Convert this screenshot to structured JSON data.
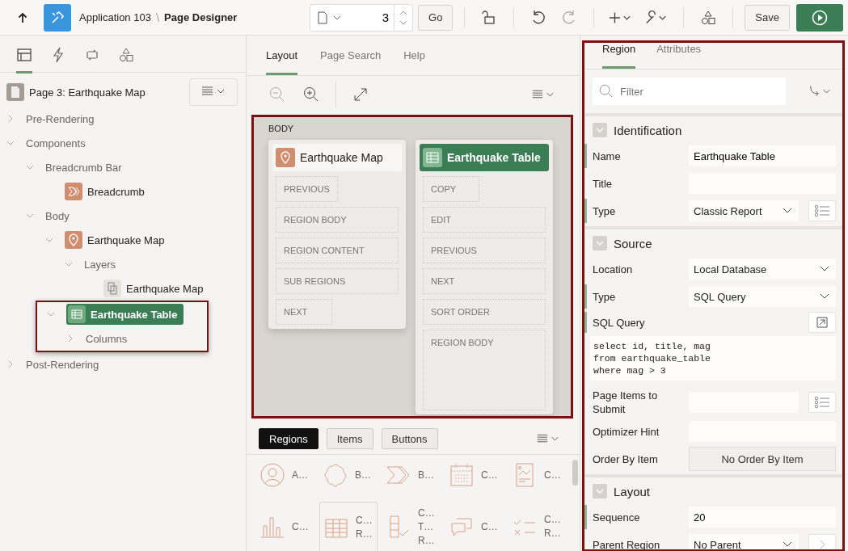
{
  "header": {
    "app_name": "Application 103",
    "separator": "\\",
    "page_title": "Page Designer",
    "page_number": "3",
    "go_label": "Go",
    "save_label": "Save"
  },
  "left_tabs": [
    {
      "kind": "tree",
      "selected": true
    },
    {
      "kind": "bolt",
      "selected": false
    },
    {
      "kind": "cycle",
      "selected": false
    },
    {
      "kind": "shapes",
      "selected": false
    }
  ],
  "tree": {
    "page_label": "Page 3: Earthquake Map",
    "nodes": [
      {
        "label": "Pre-Rendering",
        "expanded": false,
        "selected": false
      },
      {
        "label": "Components",
        "expanded": true,
        "selected": false,
        "children": [
          {
            "label": "Breadcrumb Bar",
            "expanded": true,
            "selected": false,
            "children": [
              {
                "label": "Breadcrumb",
                "kind": "breadcrumb",
                "selected": false
              }
            ]
          },
          {
            "label": "Body",
            "expanded": true,
            "selected": false,
            "children": [
              {
                "label": "Earthquake Map",
                "kind": "map",
                "expanded": true,
                "selected": false,
                "children": [
                  {
                    "label": "Layers",
                    "expanded": true,
                    "selected": false,
                    "children": [
                      {
                        "label": "Earthquake Map",
                        "kind": "layer",
                        "selected": false
                      }
                    ]
                  }
                ]
              },
              {
                "label": "Earthquake Table",
                "kind": "table",
                "expanded": true,
                "selected": true,
                "highlighted": true,
                "children": [
                  {
                    "label": "Columns",
                    "expanded": false,
                    "selected": false
                  }
                ]
              }
            ]
          }
        ]
      },
      {
        "label": "Post-Rendering",
        "expanded": false,
        "selected": false
      }
    ]
  },
  "center_tabs": [
    {
      "label": "Layout",
      "selected": true
    },
    {
      "label": "Page Search",
      "selected": false
    },
    {
      "label": "Help",
      "selected": false
    }
  ],
  "canvas": {
    "label": "BODY",
    "highlighted": true,
    "regions": [
      {
        "title": "Earthquake Map",
        "kind": "map",
        "selected": false,
        "slots": [
          "PREVIOUS",
          "REGION BODY",
          "REGION CONTENT",
          "SUB REGIONS",
          "NEXT"
        ]
      },
      {
        "title": "Earthquake Table",
        "kind": "table",
        "selected": true,
        "slots": [
          "COPY",
          "EDIT",
          "PREVIOUS",
          "NEXT",
          "SORT ORDER",
          "REGION BODY"
        ]
      }
    ]
  },
  "gallery_tabs": [
    {
      "label": "Regions",
      "selected": true
    },
    {
      "label": "Items",
      "selected": false
    },
    {
      "label": "Buttons",
      "selected": false
    }
  ],
  "gallery": [
    {
      "kind": "avatar",
      "lines": [
        "A…"
      ],
      "selected": false
    },
    {
      "kind": "badge",
      "lines": [
        "B…"
      ],
      "selected": false
    },
    {
      "kind": "breadcrumb",
      "lines": [
        "B…"
      ],
      "selected": false
    },
    {
      "kind": "calendar",
      "lines": [
        "C…"
      ],
      "selected": false
    },
    {
      "kind": "card",
      "lines": [
        "C…"
      ],
      "selected": false
    },
    {
      "kind": "chart",
      "lines": [
        "C…"
      ],
      "selected": false
    },
    {
      "kind": "grid",
      "lines": [
        "C…",
        "R…"
      ],
      "selected": true
    },
    {
      "kind": "checktable",
      "lines": [
        "C…",
        "T…",
        "R…"
      ],
      "selected": false
    },
    {
      "kind": "comments",
      "lines": [
        "C…"
      ],
      "selected": false
    },
    {
      "kind": "checklist",
      "lines": [
        "C…",
        "R…"
      ],
      "selected": false
    }
  ],
  "properties": {
    "highlighted": true,
    "tabs": [
      {
        "label": "Region",
        "selected": true
      },
      {
        "label": "Attributes",
        "selected": false
      }
    ],
    "filter_placeholder": "Filter",
    "groups": [
      {
        "title": "Identification",
        "expanded": true,
        "fields": [
          {
            "label": "Name",
            "kind": "text",
            "value": "Earthquake Table",
            "required": true
          },
          {
            "label": "Title",
            "kind": "text",
            "required": false
          },
          {
            "label": "Type",
            "kind": "select-list",
            "value": "Classic Report",
            "required": true
          }
        ]
      },
      {
        "title": "Source",
        "expanded": true,
        "fields": [
          {
            "label": "Location",
            "kind": "select",
            "value": "Local Database",
            "required": false
          },
          {
            "label": "Type",
            "kind": "select",
            "value": "SQL Query",
            "required": true
          },
          {
            "label": "SQL Query",
            "kind": "code",
            "lines": [
              "select id, title, mag",
              "from earthquake_table",
              "where mag > 3"
            ],
            "required": true
          },
          {
            "label": "Page Items to Submit",
            "kind": "text-list",
            "required": false
          },
          {
            "label": "Optimizer Hint",
            "kind": "text",
            "required": false
          },
          {
            "label": "Order By Item",
            "kind": "button",
            "value": "No Order By Item",
            "required": false
          }
        ]
      },
      {
        "title": "Layout",
        "expanded": true,
        "fields": [
          {
            "label": "Sequence",
            "kind": "text",
            "value": "20",
            "required": true
          },
          {
            "label": "Parent Region",
            "kind": "select-nav",
            "value": "No Parent",
            "required": false
          }
        ]
      }
    ]
  }
}
